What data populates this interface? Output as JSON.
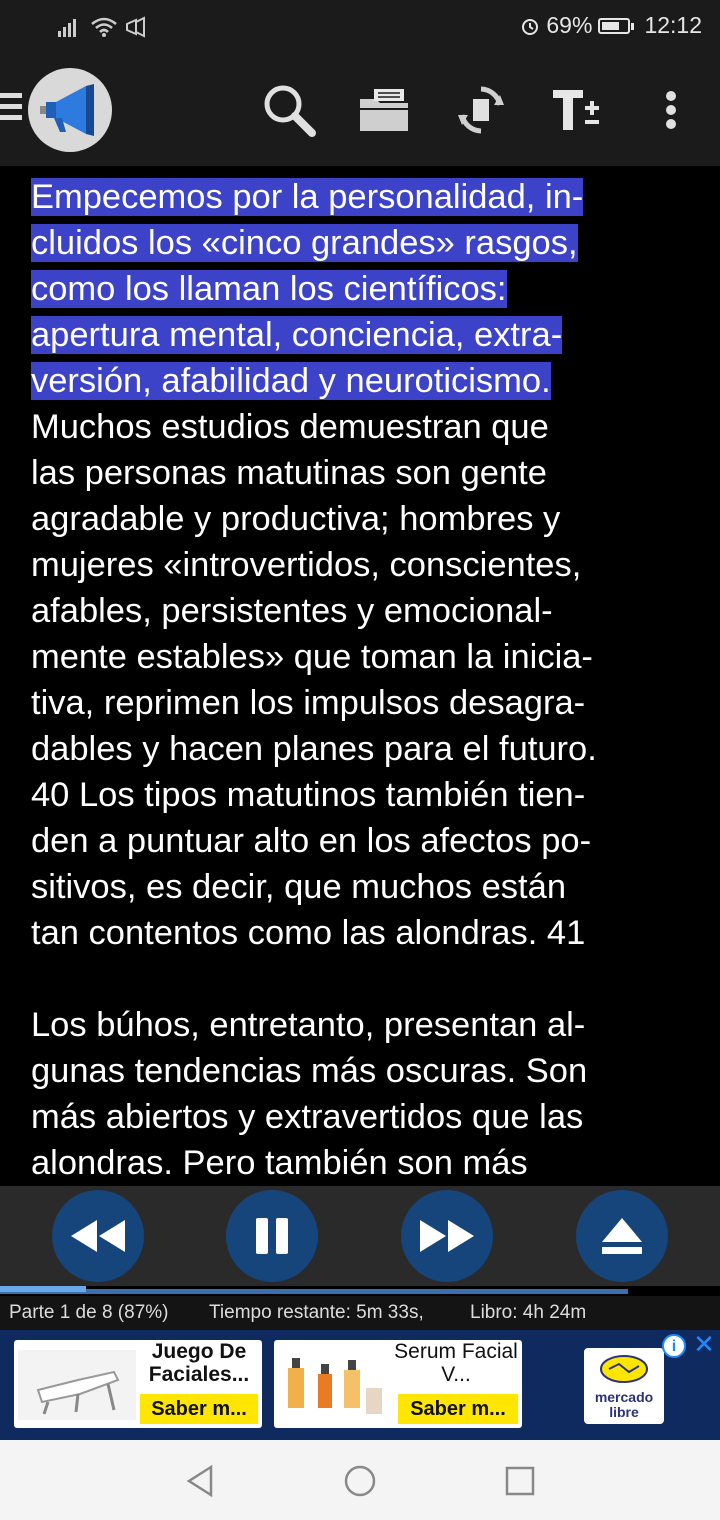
{
  "status_bar": {
    "battery": "69%",
    "time": "12:12",
    "battery_level": 0.69
  },
  "toolbar": {
    "icons": [
      "menu-icon",
      "megaphone-logo",
      "search-icon",
      "folder-icon",
      "sync-icon",
      "text-size-icon",
      "more-vert-icon"
    ]
  },
  "reader": {
    "highlighted_lines": [
      "Empecemos por la personalidad, in-",
      "cluidos los «cinco grandes» rasgos,",
      "como los llaman los científicos:",
      "apertura mental, conciencia, extra-",
      "versión, afabilidad y neuroticismo."
    ],
    "body_lines": [
      "Muchos estudios demuestran que",
      "las personas matutinas son gente",
      "agradable y productiva; hombres y",
      "mujeres «introvertidos, conscientes,",
      "afables, persistentes y emocional-",
      "mente estables» que toman la inicia-",
      "tiva, reprimen los impulsos desagra-",
      "dables y hacen planes para el futuro.",
      "40 Los tipos matutinos también tien-",
      "den a puntuar alto en los afectos po-",
      "sitivos, es decir, que muchos están",
      "tan contentos como las alondras. 41"
    ],
    "para2_lines": [
      "Los búhos, entretanto, presentan al-",
      "gunas tendencias más oscuras. Son",
      "más abiertos y extravertidos que las",
      "alondras. Pero también son más"
    ]
  },
  "player": {
    "buttons": [
      "rewind-icon",
      "pause-icon",
      "fast-forward-icon",
      "eject-icon"
    ],
    "progress_fraction": 0.12
  },
  "info": {
    "part": "Parte 1 de 8 (87%)",
    "remaining": "Tiempo restante: 5m 33s,",
    "book": "Libro: 4h 24m"
  },
  "ad": {
    "card1_title": "Juego De Faciales...",
    "card1_cta": "Saber m...",
    "card2_title": "Serum Facial V...",
    "card2_cta": "Saber m...",
    "brand": "mercado libre",
    "info_glyph": "i",
    "close_glyph": "✕"
  }
}
